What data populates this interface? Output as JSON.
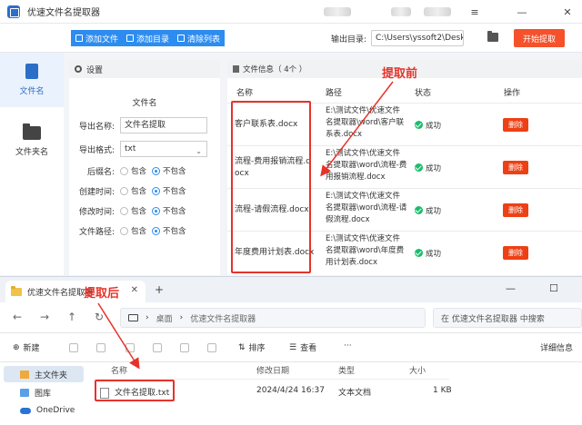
{
  "app": {
    "title": "优速文件名提取器",
    "controls": {
      "menu": "≡",
      "minimize": "—",
      "close": "✕"
    }
  },
  "toolbar": {
    "add_file": "添加文件",
    "add_dir": "添加目录",
    "clear_list": "清除列表",
    "output_label": "输出目录:",
    "output_path": "C:\\Users\\yssoft2\\Deskt",
    "start": "开始提取"
  },
  "sidebar": {
    "items": [
      {
        "label": "文件名",
        "active": true
      },
      {
        "label": "文件夹名",
        "active": false
      }
    ]
  },
  "settings": {
    "header": "设置",
    "subtitle": "文件名",
    "export_name_label": "导出名称:",
    "export_name_value": "文件名提取",
    "export_format_label": "导出格式:",
    "export_format_value": "txt",
    "rows": [
      {
        "label": "后缀名:",
        "include": "包含",
        "exclude": "不包含",
        "selected": "exclude"
      },
      {
        "label": "创建时间:",
        "include": "包含",
        "exclude": "不包含",
        "selected": "exclude"
      },
      {
        "label": "修改时间:",
        "include": "包含",
        "exclude": "不包含",
        "selected": "exclude"
      },
      {
        "label": "文件路径:",
        "include": "包含",
        "exclude": "不包含",
        "selected": "exclude"
      }
    ]
  },
  "files": {
    "header": "文件信息（ 4个 ）",
    "columns": {
      "name": "名称",
      "path": "路径",
      "status": "状态",
      "action": "操作"
    },
    "rows": [
      {
        "name": "客户联系表.docx",
        "path": "E:\\测试文件\\优速文件名提取器\\word\\客户联系表.docx",
        "status": "成功",
        "action": "删除"
      },
      {
        "name": "流程-费用报销流程.docx",
        "path": "E:\\测试文件\\优速文件名提取器\\word\\流程-费用报销流程.docx",
        "status": "成功",
        "action": "删除"
      },
      {
        "name": "流程-请假流程.docx",
        "path": "E:\\测试文件\\优速文件名提取器\\word\\流程-请假流程.docx",
        "status": "成功",
        "action": "删除"
      },
      {
        "name": "年度费用计划表.docx",
        "path": "E:\\测试文件\\优速文件名提取器\\word\\年度费用计划表.docx",
        "status": "成功",
        "action": "删除"
      }
    ]
  },
  "annotations": {
    "before": "提取前",
    "after": "提取后"
  },
  "explorer": {
    "tab": "优速文件名提取器",
    "tab_close": "✕",
    "tab_new": "+",
    "controls": {
      "minimize": "—",
      "maximize": "☐"
    },
    "breadcrumb": [
      "桌面",
      "优速文件名提取器"
    ],
    "search_placeholder": "在 优速文件名提取器 中搜索",
    "new_label": "新建",
    "sort_label": "排序",
    "view_label": "查看",
    "more_label": "···",
    "details_label": "详细信息",
    "nav": [
      {
        "label": "主文件夹",
        "icon": "home-icon"
      },
      {
        "label": "图库",
        "icon": "gallery-icon"
      },
      {
        "label": "OneDrive",
        "icon": "cloud-icon"
      }
    ],
    "columns": {
      "name": "名称",
      "modified": "修改日期",
      "type": "类型",
      "size": "大小"
    },
    "file": {
      "name": "文件名提取.txt",
      "modified": "2024/4/24 16:37",
      "type": "文本文档",
      "size": "1 KB"
    }
  }
}
